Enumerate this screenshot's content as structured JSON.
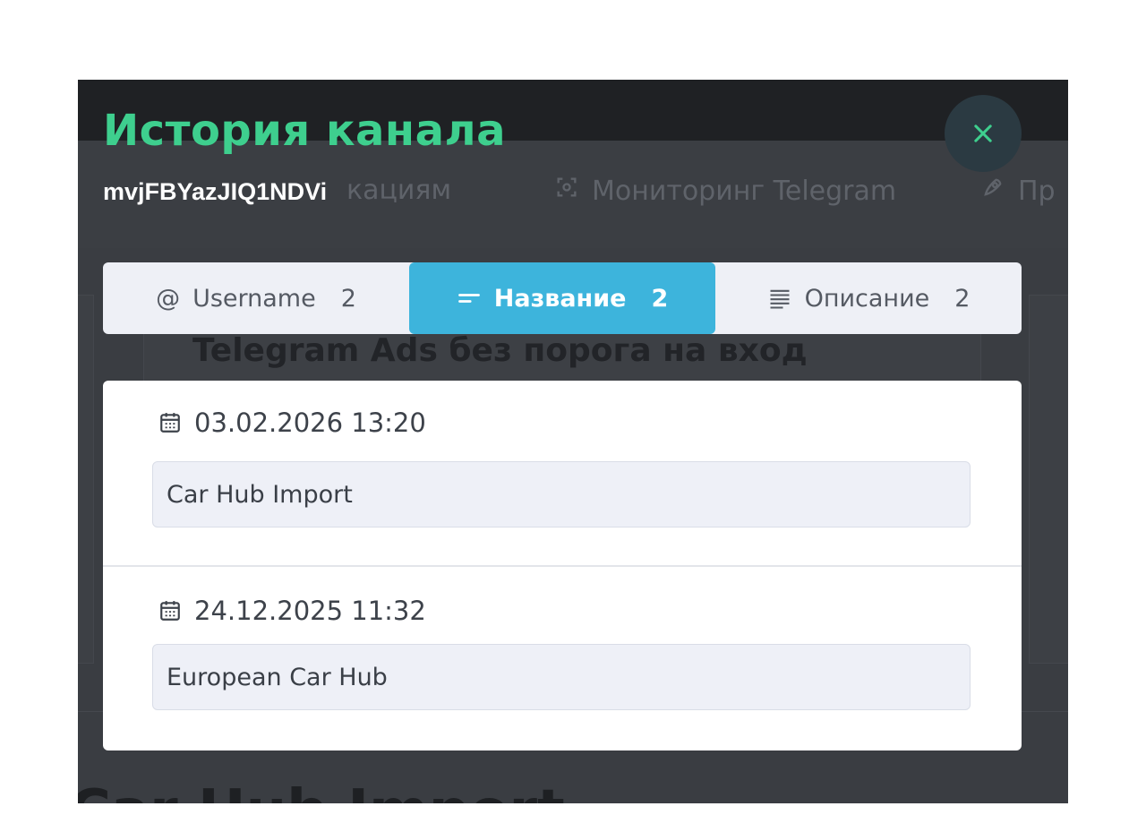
{
  "background": {
    "nav_items": [
      {
        "label": "кациям",
        "icon": "document-icon"
      },
      {
        "label": "Мониторинг Telegram",
        "icon": "monitor-icon"
      },
      {
        "label": "Пр",
        "icon": "rocket-icon"
      }
    ],
    "card_title": "Telegram Ads без порога на вход",
    "bottom_title": "Car Hub Import"
  },
  "modal": {
    "title": "История канала",
    "subtitle": "mvjFBYazJIQ1NDVi",
    "close_icon": "close-icon",
    "accent_color": "#3ecf8e",
    "tabs": [
      {
        "label": "Username",
        "count": "2",
        "icon": "at-icon",
        "active": false
      },
      {
        "label": "Название",
        "count": "2",
        "icon": "title-lines-icon",
        "active": true
      },
      {
        "label": "Описание",
        "count": "2",
        "icon": "align-lines-icon",
        "active": false
      }
    ],
    "active_tab_color": "#3db4dc",
    "entries": [
      {
        "date": "03.02.2026 13:20",
        "value": "Car Hub Import",
        "icon": "calendar-icon"
      },
      {
        "date": "24.12.2025 11:32",
        "value": "European Car Hub",
        "icon": "calendar-icon"
      }
    ]
  }
}
